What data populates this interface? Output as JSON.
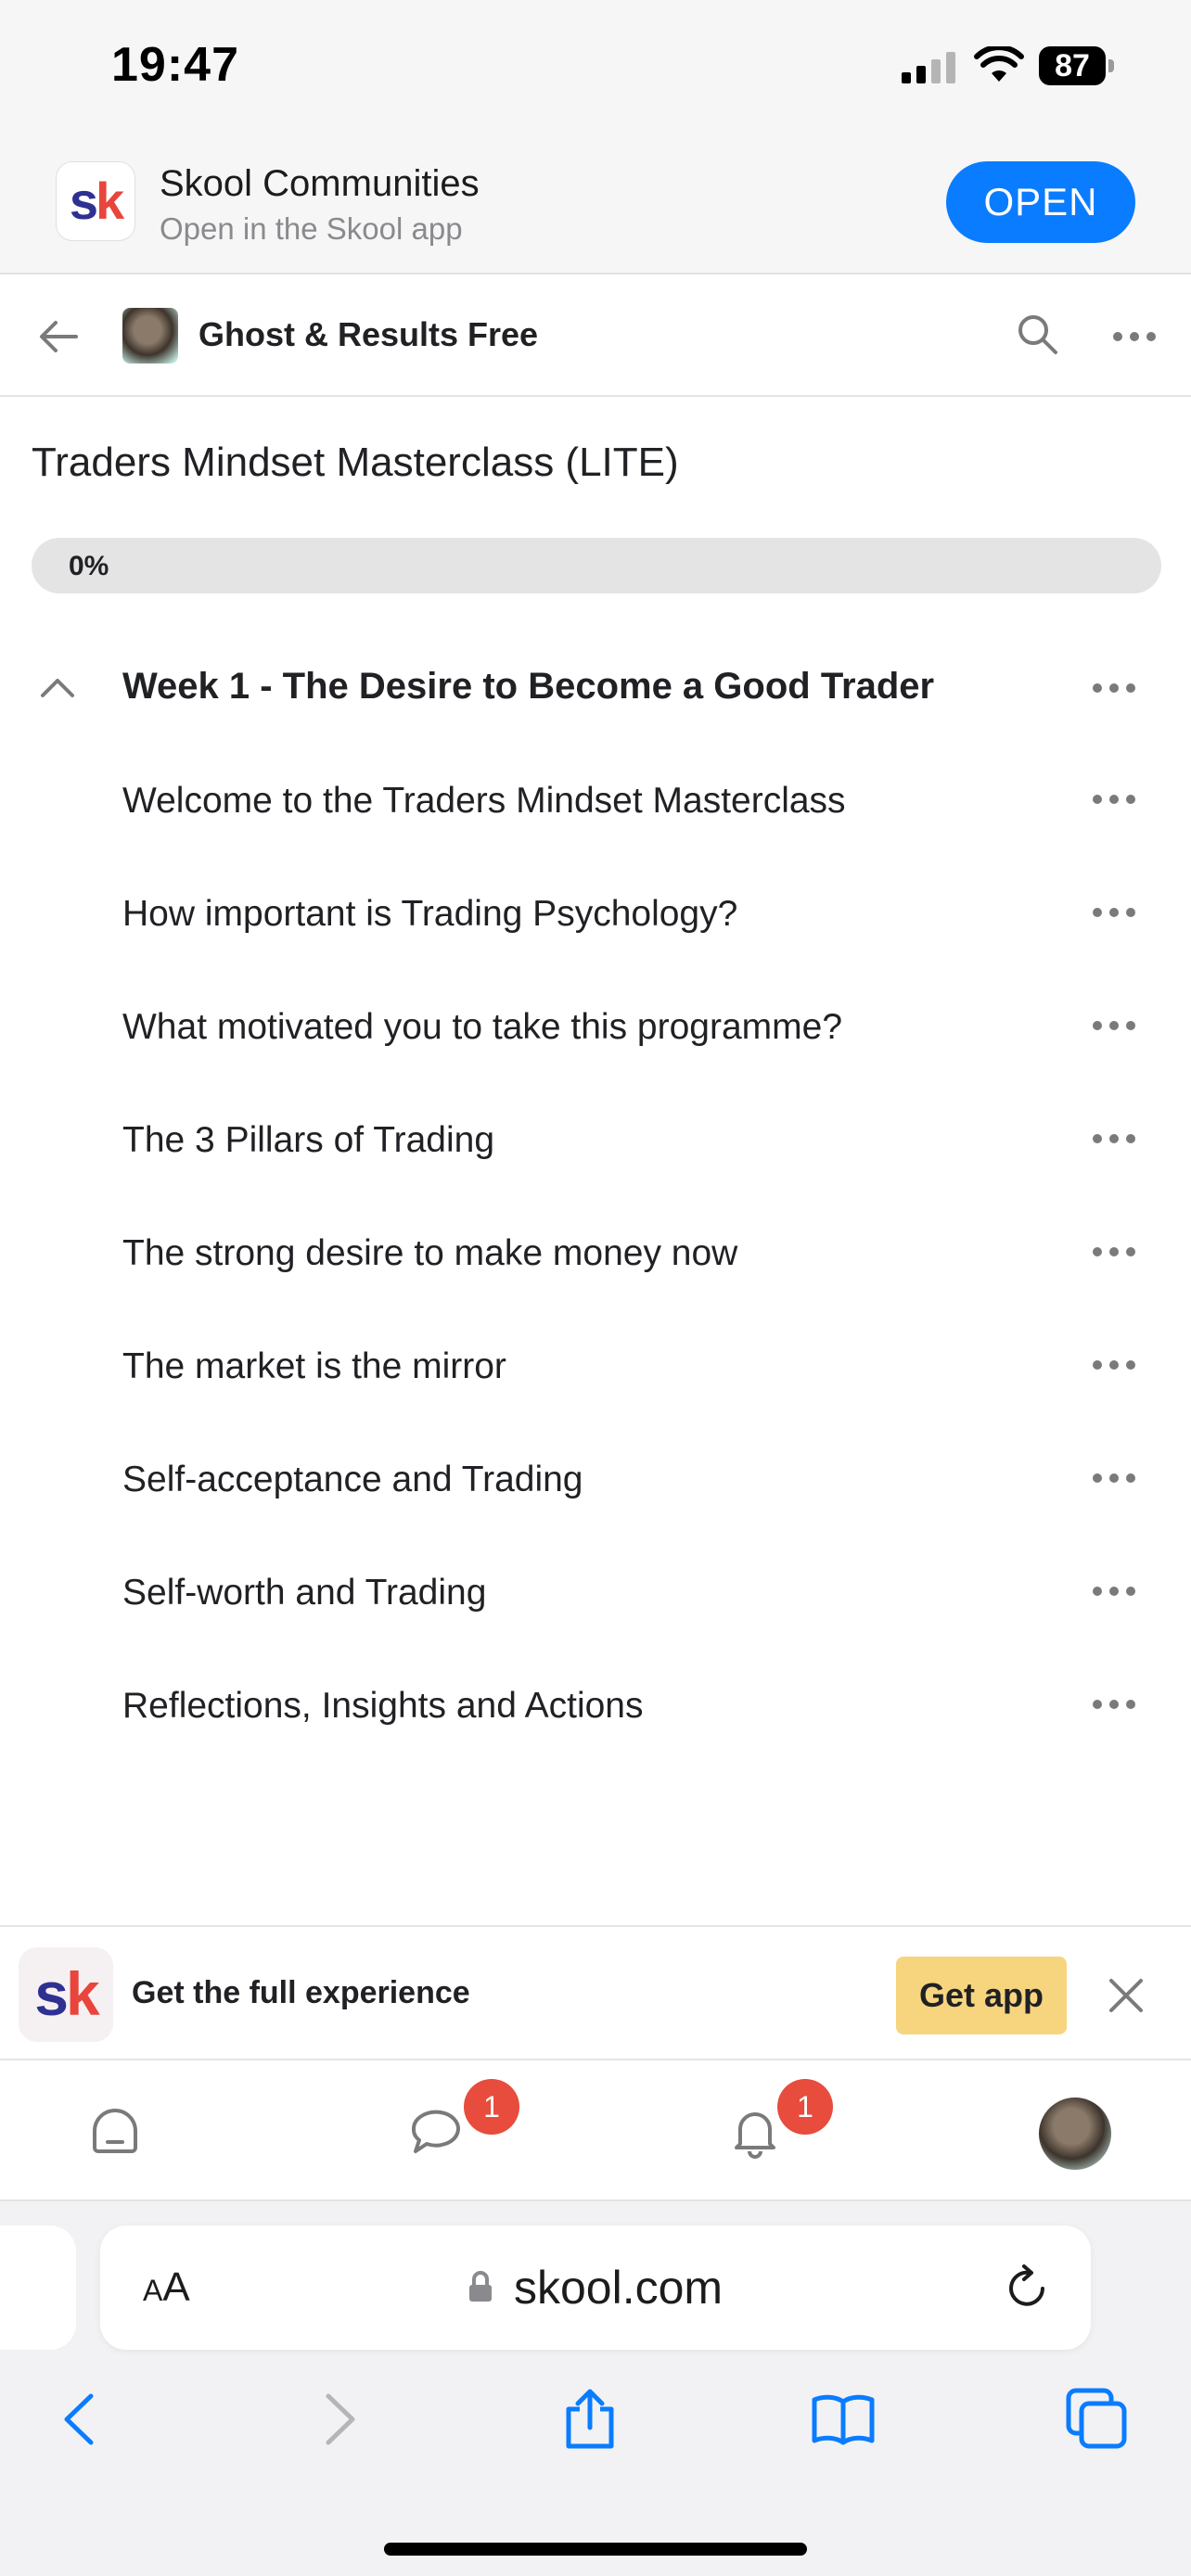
{
  "status_bar": {
    "time": "19:47",
    "battery": "87"
  },
  "app_banner": {
    "title": "Skool Communities",
    "subtitle": "Open in the Skool app",
    "open_label": "OPEN",
    "logo_s": "s",
    "logo_k": "k"
  },
  "header": {
    "group_name": "Ghost & Results Free"
  },
  "course": {
    "title": "Traders Mindset Masterclass (LITE)",
    "progress_label": "0%",
    "progress": 0,
    "section": {
      "title": "Week 1 - The Desire to Become a Good Trader",
      "expanded": true,
      "lessons": [
        {
          "title": "Welcome to the Traders Mindset Masterclass"
        },
        {
          "title": "How important is Trading Psychology?"
        },
        {
          "title": "What motivated you to take this programme?"
        },
        {
          "title": "The 3 Pillars of Trading"
        },
        {
          "title": "The strong desire to make money now"
        },
        {
          "title": "The market is the mirror"
        },
        {
          "title": "Self-acceptance and Trading"
        },
        {
          "title": "Self-worth and Trading"
        },
        {
          "title": "Reflections, Insights and Actions"
        }
      ]
    }
  },
  "get_app": {
    "text": "Get the full experience",
    "button_label": "Get app"
  },
  "bottom_nav": {
    "chat_badge": "1",
    "notifications_badge": "1"
  },
  "browser": {
    "aa_label_small": "A",
    "aa_label_large": "A",
    "url": "skool.com"
  },
  "colors": {
    "accent_blue": "#0a7cff",
    "logo_blue": "#2e3192",
    "logo_red": "#e8453c",
    "badge_red": "#e74c3c",
    "get_app_yellow": "#f7d57f"
  }
}
